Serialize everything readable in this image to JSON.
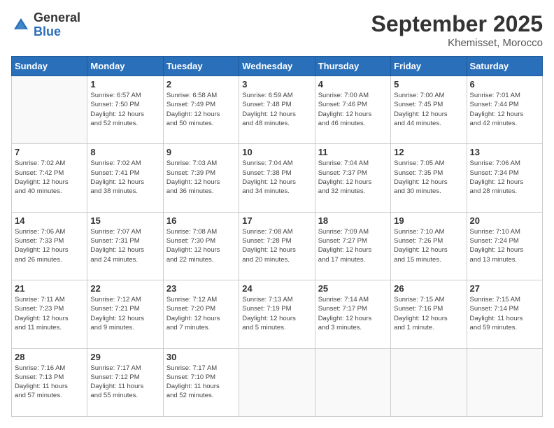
{
  "logo": {
    "general": "General",
    "blue": "Blue"
  },
  "title": "September 2025",
  "subtitle": "Khemisset, Morocco",
  "days_header": [
    "Sunday",
    "Monday",
    "Tuesday",
    "Wednesday",
    "Thursday",
    "Friday",
    "Saturday"
  ],
  "weeks": [
    [
      {
        "day": "",
        "info": ""
      },
      {
        "day": "1",
        "info": "Sunrise: 6:57 AM\nSunset: 7:50 PM\nDaylight: 12 hours\nand 52 minutes."
      },
      {
        "day": "2",
        "info": "Sunrise: 6:58 AM\nSunset: 7:49 PM\nDaylight: 12 hours\nand 50 minutes."
      },
      {
        "day": "3",
        "info": "Sunrise: 6:59 AM\nSunset: 7:48 PM\nDaylight: 12 hours\nand 48 minutes."
      },
      {
        "day": "4",
        "info": "Sunrise: 7:00 AM\nSunset: 7:46 PM\nDaylight: 12 hours\nand 46 minutes."
      },
      {
        "day": "5",
        "info": "Sunrise: 7:00 AM\nSunset: 7:45 PM\nDaylight: 12 hours\nand 44 minutes."
      },
      {
        "day": "6",
        "info": "Sunrise: 7:01 AM\nSunset: 7:44 PM\nDaylight: 12 hours\nand 42 minutes."
      }
    ],
    [
      {
        "day": "7",
        "info": "Sunrise: 7:02 AM\nSunset: 7:42 PM\nDaylight: 12 hours\nand 40 minutes."
      },
      {
        "day": "8",
        "info": "Sunrise: 7:02 AM\nSunset: 7:41 PM\nDaylight: 12 hours\nand 38 minutes."
      },
      {
        "day": "9",
        "info": "Sunrise: 7:03 AM\nSunset: 7:39 PM\nDaylight: 12 hours\nand 36 minutes."
      },
      {
        "day": "10",
        "info": "Sunrise: 7:04 AM\nSunset: 7:38 PM\nDaylight: 12 hours\nand 34 minutes."
      },
      {
        "day": "11",
        "info": "Sunrise: 7:04 AM\nSunset: 7:37 PM\nDaylight: 12 hours\nand 32 minutes."
      },
      {
        "day": "12",
        "info": "Sunrise: 7:05 AM\nSunset: 7:35 PM\nDaylight: 12 hours\nand 30 minutes."
      },
      {
        "day": "13",
        "info": "Sunrise: 7:06 AM\nSunset: 7:34 PM\nDaylight: 12 hours\nand 28 minutes."
      }
    ],
    [
      {
        "day": "14",
        "info": "Sunrise: 7:06 AM\nSunset: 7:33 PM\nDaylight: 12 hours\nand 26 minutes."
      },
      {
        "day": "15",
        "info": "Sunrise: 7:07 AM\nSunset: 7:31 PM\nDaylight: 12 hours\nand 24 minutes."
      },
      {
        "day": "16",
        "info": "Sunrise: 7:08 AM\nSunset: 7:30 PM\nDaylight: 12 hours\nand 22 minutes."
      },
      {
        "day": "17",
        "info": "Sunrise: 7:08 AM\nSunset: 7:28 PM\nDaylight: 12 hours\nand 20 minutes."
      },
      {
        "day": "18",
        "info": "Sunrise: 7:09 AM\nSunset: 7:27 PM\nDaylight: 12 hours\nand 17 minutes."
      },
      {
        "day": "19",
        "info": "Sunrise: 7:10 AM\nSunset: 7:26 PM\nDaylight: 12 hours\nand 15 minutes."
      },
      {
        "day": "20",
        "info": "Sunrise: 7:10 AM\nSunset: 7:24 PM\nDaylight: 12 hours\nand 13 minutes."
      }
    ],
    [
      {
        "day": "21",
        "info": "Sunrise: 7:11 AM\nSunset: 7:23 PM\nDaylight: 12 hours\nand 11 minutes."
      },
      {
        "day": "22",
        "info": "Sunrise: 7:12 AM\nSunset: 7:21 PM\nDaylight: 12 hours\nand 9 minutes."
      },
      {
        "day": "23",
        "info": "Sunrise: 7:12 AM\nSunset: 7:20 PM\nDaylight: 12 hours\nand 7 minutes."
      },
      {
        "day": "24",
        "info": "Sunrise: 7:13 AM\nSunset: 7:19 PM\nDaylight: 12 hours\nand 5 minutes."
      },
      {
        "day": "25",
        "info": "Sunrise: 7:14 AM\nSunset: 7:17 PM\nDaylight: 12 hours\nand 3 minutes."
      },
      {
        "day": "26",
        "info": "Sunrise: 7:15 AM\nSunset: 7:16 PM\nDaylight: 12 hours\nand 1 minute."
      },
      {
        "day": "27",
        "info": "Sunrise: 7:15 AM\nSunset: 7:14 PM\nDaylight: 11 hours\nand 59 minutes."
      }
    ],
    [
      {
        "day": "28",
        "info": "Sunrise: 7:16 AM\nSunset: 7:13 PM\nDaylight: 11 hours\nand 57 minutes."
      },
      {
        "day": "29",
        "info": "Sunrise: 7:17 AM\nSunset: 7:12 PM\nDaylight: 11 hours\nand 55 minutes."
      },
      {
        "day": "30",
        "info": "Sunrise: 7:17 AM\nSunset: 7:10 PM\nDaylight: 11 hours\nand 52 minutes."
      },
      {
        "day": "",
        "info": ""
      },
      {
        "day": "",
        "info": ""
      },
      {
        "day": "",
        "info": ""
      },
      {
        "day": "",
        "info": ""
      }
    ]
  ]
}
